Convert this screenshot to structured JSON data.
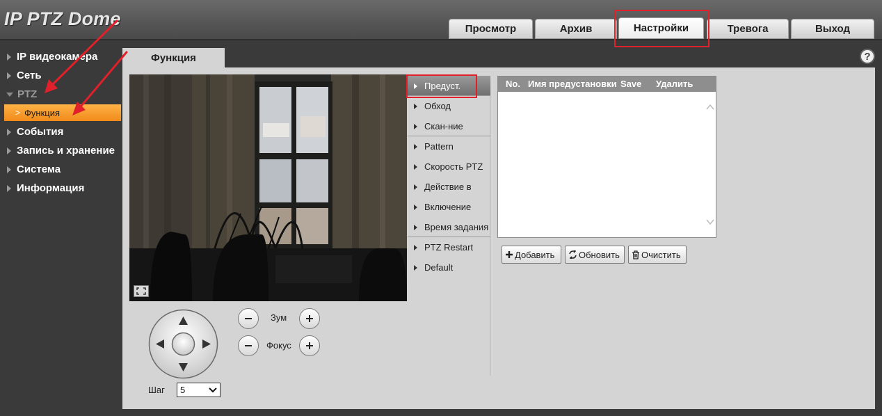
{
  "app": {
    "title": "IP PTZ Dome"
  },
  "topnav": {
    "tabs": [
      {
        "label": "Просмотр"
      },
      {
        "label": "Архив"
      },
      {
        "label": "Настройки",
        "active": true
      },
      {
        "label": "Тревога"
      },
      {
        "label": "Выход"
      }
    ]
  },
  "sidebar": {
    "items": [
      {
        "label": "IP видеокамера"
      },
      {
        "label": "Сеть"
      },
      {
        "label": "PTZ",
        "expanded": true
      },
      {
        "label": "События"
      },
      {
        "label": "Запись и хранение"
      },
      {
        "label": "Система"
      },
      {
        "label": "Информация"
      }
    ],
    "sub_item": {
      "label": "Функция"
    }
  },
  "panel": {
    "tab_label": "Функция",
    "help_icon": "?"
  },
  "ptz": {
    "zoom_label": "Зум",
    "focus_label": "Фокус",
    "step_label": "Шаг",
    "step_value": "5"
  },
  "menu": {
    "items": [
      {
        "label": "Предуст.",
        "active": true
      },
      {
        "label": "Обход"
      },
      {
        "label": "Скан-ние"
      },
      {
        "label": "Pattern"
      },
      {
        "label": "Скорость PTZ"
      },
      {
        "label": "Действие в"
      },
      {
        "label": "Включение"
      },
      {
        "label": "Время задания"
      },
      {
        "label": "PTZ Restart"
      },
      {
        "label": "Default"
      }
    ]
  },
  "preset_table": {
    "columns": [
      "No.",
      "Имя предустановки",
      "Save",
      "Удалить"
    ],
    "rows": []
  },
  "actions": {
    "add_label": "Добавить",
    "refresh_label": "Обновить",
    "clear_label": "Очистить"
  },
  "colors": {
    "accent_orange": "#f5a030",
    "annotation_red": "#e0202a",
    "panel_bg": "#d4d4d4",
    "sidebar_bg": "#3a3a3a"
  }
}
